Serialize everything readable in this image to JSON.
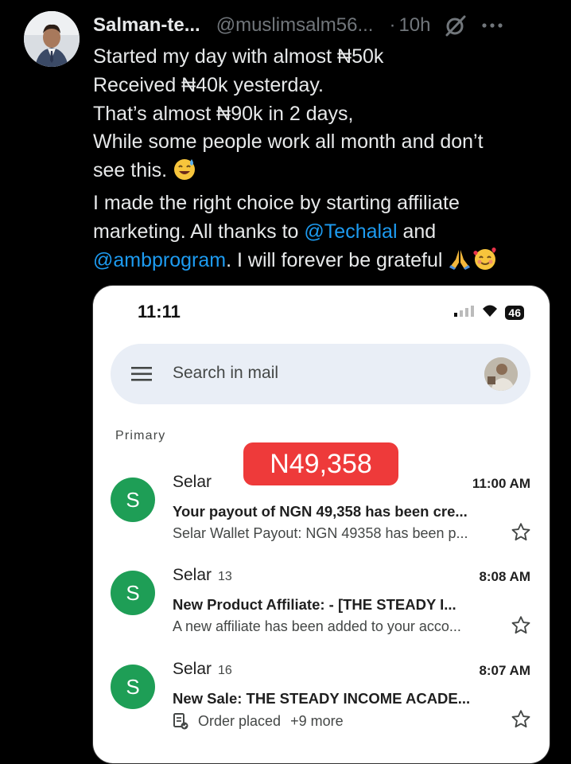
{
  "tweet": {
    "author_name": "Salman-te...",
    "handle": "@muslimsalm56...",
    "dot": "·",
    "time": "10h",
    "lines": {
      "l1": "Started my day with almost ₦50k",
      "l2": "Received ₦40k yesterday.",
      "l3": "That’s almost ₦90k in 2 days,",
      "l4": "While some people work all month and don’t",
      "l5": "see this.",
      "l6": "I made the right choice by starting affiliate",
      "l7a": "marketing. All thanks to ",
      "l7_mention": "@Techalal",
      "l7b": " and",
      "l8_mention": "@ambprogram",
      "l8b": ". I will forever be grateful"
    },
    "link_color": "#1d9bf0"
  },
  "phone": {
    "status_time": "11:11",
    "battery": "46",
    "search_placeholder": "Search in mail",
    "section_label": "Primary",
    "highlight_amount": "N49,358",
    "highlight_color": "#ee3a3a",
    "emails": [
      {
        "avatar_letter": "S",
        "sender": "Selar",
        "count": "",
        "time": "11:00 AM",
        "subject": "Your payout of NGN 49,358 has been cre...",
        "snippet": "Selar Wallet Payout: NGN 49358 has been p..."
      },
      {
        "avatar_letter": "S",
        "sender": "Selar",
        "count": "13",
        "time": "8:08 AM",
        "subject": "New Product Affiliate:  -  [THE STEADY I...",
        "snippet": "A new affiliate has been added to your acco..."
      },
      {
        "avatar_letter": "S",
        "sender": "Selar",
        "count": "16",
        "time": "8:07 AM",
        "subject": "New Sale: THE STEADY INCOME ACADE...",
        "snippet": "Order placed",
        "more": "+9 more"
      }
    ],
    "avatar_color": "#1e9e56"
  }
}
